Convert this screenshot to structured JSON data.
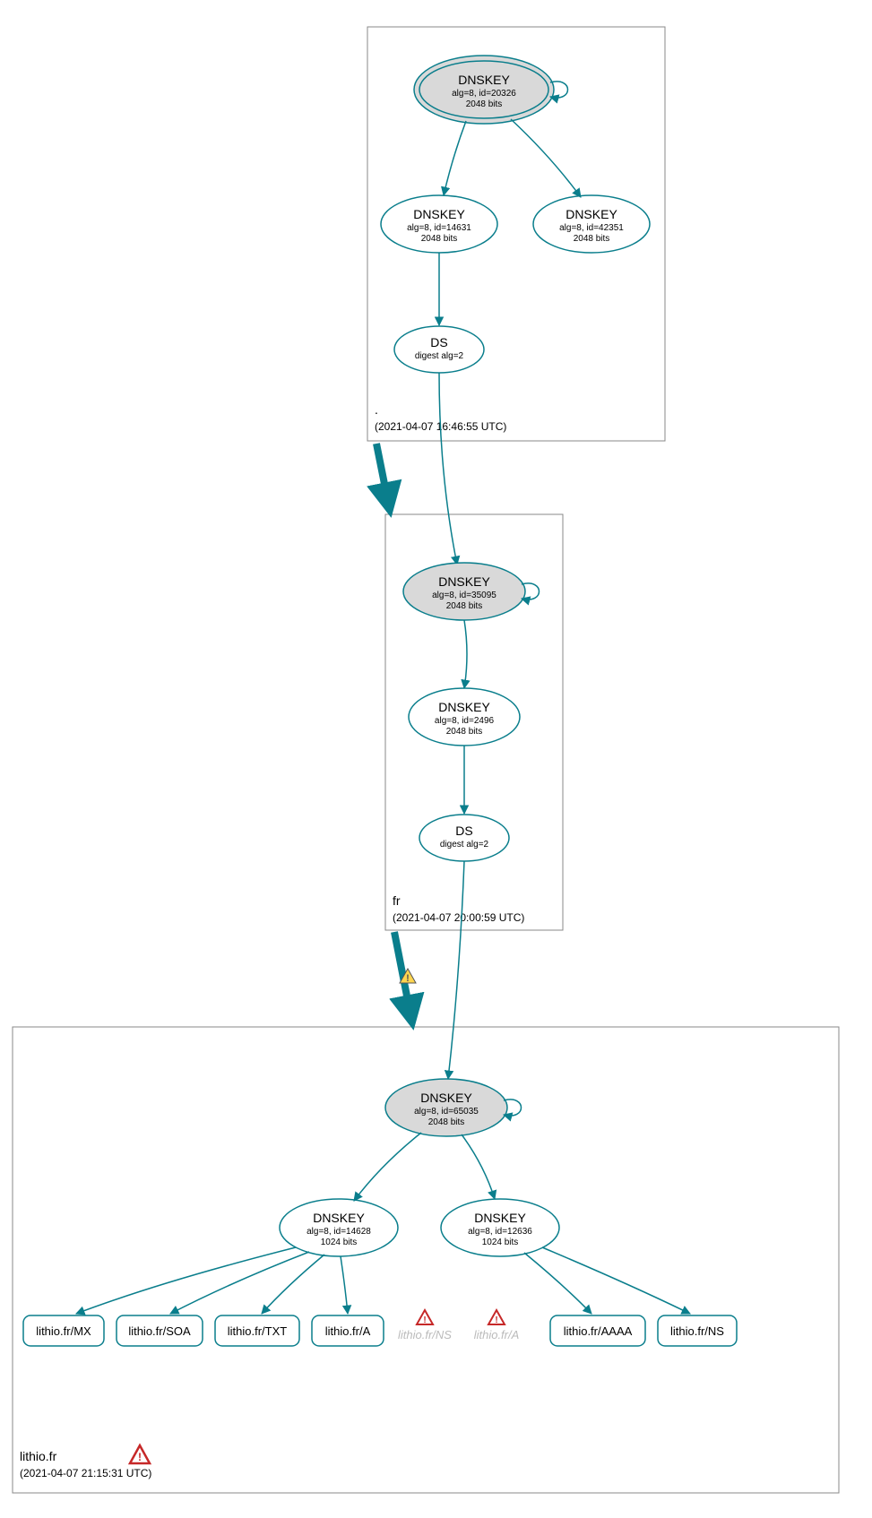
{
  "colors": {
    "stroke": "#0a7e8c",
    "fill_key": "#d9d9d9",
    "zone_border": "#888",
    "text": "#000",
    "warn_fill": "#ffd54f",
    "warn_stroke": "#555",
    "err_stroke": "#c62828"
  },
  "zones": {
    "root": {
      "label": ".",
      "timestamp": "(2021-04-07 16:46:55 UTC)"
    },
    "fr": {
      "label": "fr",
      "timestamp": "(2021-04-07 20:00:59 UTC)"
    },
    "lithio": {
      "label": "lithio.fr",
      "timestamp": "(2021-04-07 21:15:31 UTC)"
    }
  },
  "nodes": {
    "root_ksk": {
      "title": "DNSKEY",
      "line1": "alg=8, id=20326",
      "line2": "2048 bits"
    },
    "root_zsk1": {
      "title": "DNSKEY",
      "line1": "alg=8, id=14631",
      "line2": "2048 bits"
    },
    "root_zsk2": {
      "title": "DNSKEY",
      "line1": "alg=8, id=42351",
      "line2": "2048 bits"
    },
    "root_ds": {
      "title": "DS",
      "line1": "digest alg=2"
    },
    "fr_ksk": {
      "title": "DNSKEY",
      "line1": "alg=8, id=35095",
      "line2": "2048 bits"
    },
    "fr_zsk": {
      "title": "DNSKEY",
      "line1": "alg=8, id=2496",
      "line2": "2048 bits"
    },
    "fr_ds": {
      "title": "DS",
      "line1": "digest alg=2"
    },
    "lith_ksk": {
      "title": "DNSKEY",
      "line1": "alg=8, id=65035",
      "line2": "2048 bits"
    },
    "lith_zsk1": {
      "title": "DNSKEY",
      "line1": "alg=8, id=14628",
      "line2": "1024 bits"
    },
    "lith_zsk2": {
      "title": "DNSKEY",
      "line1": "alg=8, id=12636",
      "line2": "1024 bits"
    },
    "rr_mx": {
      "label": "lithio.fr/MX"
    },
    "rr_soa": {
      "label": "lithio.fr/SOA"
    },
    "rr_txt": {
      "label": "lithio.fr/TXT"
    },
    "rr_a": {
      "label": "lithio.fr/A"
    },
    "rr_ns_err": {
      "label": "lithio.fr/NS"
    },
    "rr_a_err": {
      "label": "lithio.fr/A"
    },
    "rr_aaaa": {
      "label": "lithio.fr/AAAA"
    },
    "rr_ns": {
      "label": "lithio.fr/NS"
    }
  }
}
